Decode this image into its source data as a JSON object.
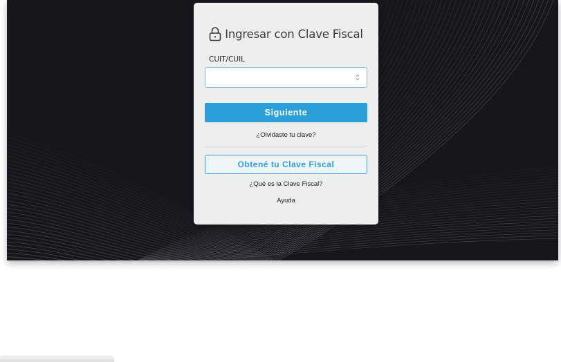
{
  "login_card": {
    "title": "Ingresar con Clave Fiscal",
    "title_icon": "lock-icon",
    "cuit_label": "CUIT/CUIL",
    "cuit_value": "",
    "cuit_placeholder": "",
    "next_button_label": "Siguiente",
    "forgot_link": "¿Olvidaste tu clave?",
    "get_key_button_label": "Obtené tu Clave Fiscal",
    "what_is_link": "¿Qué es la Clave Fiscal?",
    "help_link": "Ayuda"
  },
  "colors": {
    "background_dark": "#17161b",
    "card_background": "#eeeeee",
    "accent_blue": "#2b9fd9",
    "input_border": "#7fb8d6",
    "title_text": "#3a3a3a"
  }
}
